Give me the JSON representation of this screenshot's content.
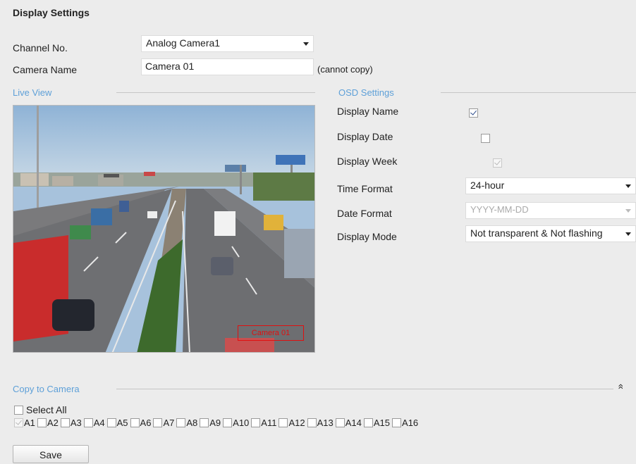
{
  "title": "Display Settings",
  "channel": {
    "label": "Channel No.",
    "value": "Analog Camera1"
  },
  "camera_name": {
    "label": "Camera Name",
    "value": "Camera 01",
    "note": "(cannot copy)"
  },
  "live_view": {
    "heading": "Live View",
    "osd_text": "Camera 01"
  },
  "osd": {
    "heading": "OSD Settings",
    "display_name": {
      "label": "Display Name",
      "checked": true
    },
    "display_date": {
      "label": "Display Date",
      "checked": false
    },
    "display_week": {
      "label": "Display Week",
      "checked": true,
      "disabled": true
    },
    "time_format": {
      "label": "Time Format",
      "value": "24-hour"
    },
    "date_format": {
      "label": "Date Format",
      "value": "YYYY-MM-DD",
      "disabled": true
    },
    "display_mode": {
      "label": "Display Mode",
      "value": "Not transparent & Not flashing"
    }
  },
  "copy": {
    "heading": "Copy to Camera",
    "collapse_glyph": "»",
    "select_all": "Select All",
    "channels": [
      "A1",
      "A2",
      "A3",
      "A4",
      "A5",
      "A6",
      "A7",
      "A8",
      "A9",
      "A10",
      "A11",
      "A12",
      "A13",
      "A14",
      "A15",
      "A16"
    ]
  },
  "save_label": "Save",
  "colors": {
    "section_heading": "#5ea0d8",
    "osd_box": "#e01010",
    "background": "#ececec"
  }
}
